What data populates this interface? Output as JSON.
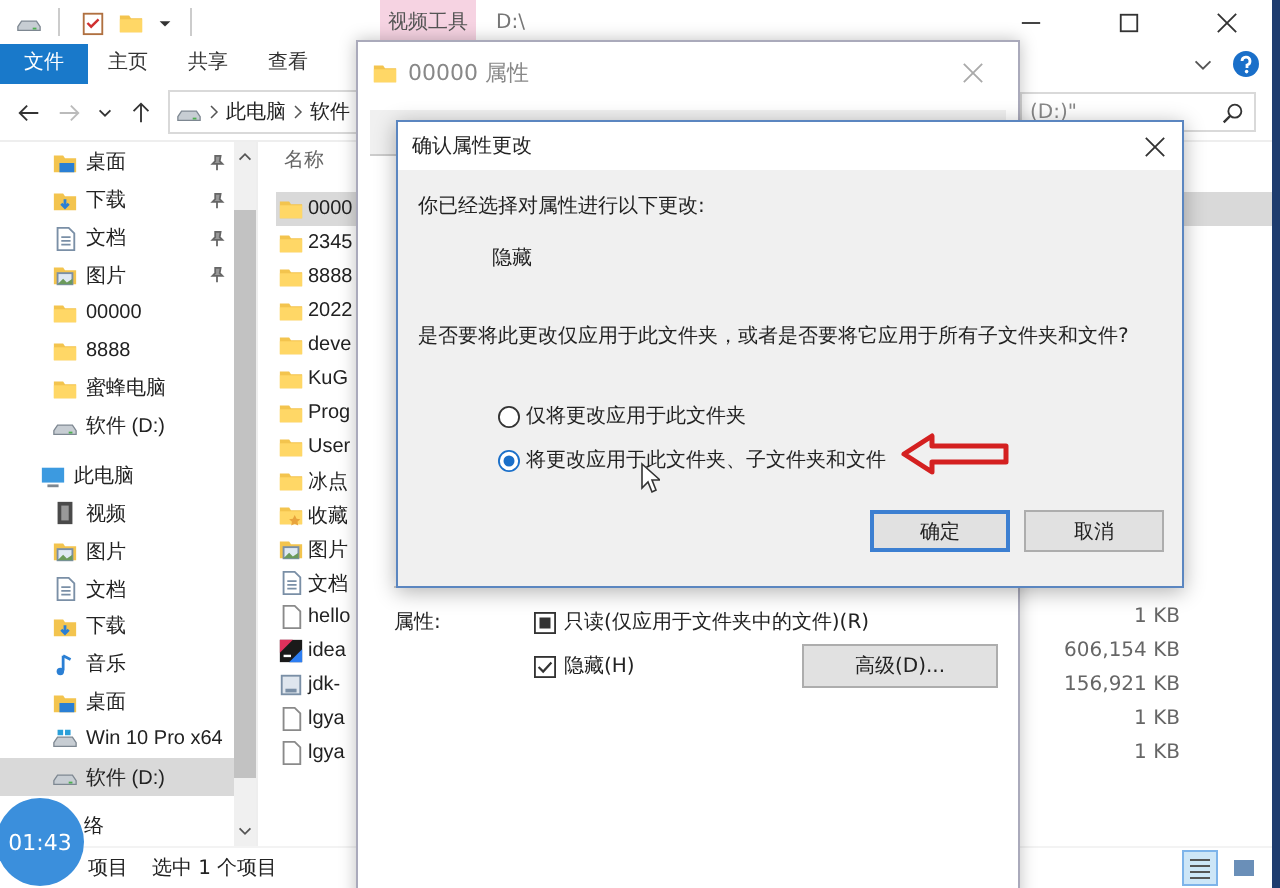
{
  "explorer": {
    "title_bar": {
      "context_tab": "视频工具",
      "path": "D:\\"
    },
    "ribbon_tabs": [
      {
        "label": "文件",
        "selected": true
      },
      {
        "label": "主页",
        "selected": false
      },
      {
        "label": "共享",
        "selected": false
      },
      {
        "label": "查看",
        "selected": false
      }
    ],
    "address": {
      "crumbs": [
        "此电脑",
        "软件"
      ]
    },
    "search": {
      "placeholder": "(D:)\""
    },
    "quick_access": [
      {
        "label": "桌面",
        "kind": "desktop",
        "pinned": true,
        "selected": false
      },
      {
        "label": "下载",
        "kind": "download",
        "pinned": true,
        "selected": false
      },
      {
        "label": "文档",
        "kind": "documents",
        "pinned": true,
        "selected": false
      },
      {
        "label": "图片",
        "kind": "pictures",
        "pinned": true,
        "selected": false
      },
      {
        "label": "00000",
        "kind": "folder",
        "pinned": false,
        "selected": false
      },
      {
        "label": "8888",
        "kind": "folder",
        "pinned": false,
        "selected": false
      },
      {
        "label": "蜜蜂电脑",
        "kind": "folder",
        "pinned": false,
        "selected": false
      },
      {
        "label": "软件 (D:)",
        "kind": "drive",
        "pinned": false,
        "selected": false
      }
    ],
    "tree": [
      {
        "label": "此电脑",
        "kind": "pc",
        "selected": false,
        "children": [
          {
            "label": "视频",
            "kind": "videos",
            "selected": false
          },
          {
            "label": "图片",
            "kind": "pictures",
            "selected": false
          },
          {
            "label": "文档",
            "kind": "documents",
            "selected": false
          },
          {
            "label": "下载",
            "kind": "download",
            "selected": false
          },
          {
            "label": "音乐",
            "kind": "music",
            "selected": false
          },
          {
            "label": "桌面",
            "kind": "desktop",
            "selected": false
          },
          {
            "label": "Win 10 Pro x64",
            "kind": "os-drive",
            "selected": false
          },
          {
            "label": "软件 (D:)",
            "kind": "drive",
            "selected": true
          }
        ]
      },
      {
        "label": "络",
        "kind": "hidden",
        "selected": false
      }
    ],
    "files": {
      "column": "名称",
      "rows": [
        {
          "name": "0000",
          "kind": "folder",
          "selected": true
        },
        {
          "name": "2345",
          "kind": "folder",
          "selected": false
        },
        {
          "name": "8888",
          "kind": "folder",
          "selected": false
        },
        {
          "name": "2022",
          "kind": "folder",
          "selected": false
        },
        {
          "name": "deve",
          "kind": "folder",
          "selected": false
        },
        {
          "name": "KuG",
          "kind": "folder",
          "selected": false
        },
        {
          "name": "Prog",
          "kind": "folder",
          "selected": false
        },
        {
          "name": "User",
          "kind": "folder",
          "selected": false
        },
        {
          "name": "冰点",
          "kind": "folder",
          "selected": false
        },
        {
          "name": "收藏",
          "kind": "favorites",
          "selected": false
        },
        {
          "name": "图片",
          "kind": "pictures",
          "selected": false
        },
        {
          "name": "文档",
          "kind": "documents",
          "selected": false
        },
        {
          "name": "hello",
          "kind": "file",
          "size": "1 KB",
          "selected": false
        },
        {
          "name": "idea",
          "kind": "app",
          "size": "606,154 KB",
          "selected": false
        },
        {
          "name": "jdk-",
          "kind": "installer",
          "size": "156,921 KB",
          "selected": false
        },
        {
          "name": "lgya",
          "kind": "file",
          "size": "1 KB",
          "selected": false
        },
        {
          "name": "lgya",
          "kind": "file",
          "size": "1 KB",
          "selected": false
        }
      ]
    },
    "status_bar": {
      "count": "项目",
      "selection": "选中 1 个项目"
    },
    "view_buttons": [
      {
        "kind": "details",
        "selected": true
      },
      {
        "kind": "large-icons",
        "selected": false
      }
    ]
  },
  "properties": {
    "title": "00000 属性",
    "attributes_label": "属性:",
    "attributes": [
      {
        "label": "只读(仅应用于文件夹中的文件)(R)",
        "checked": false,
        "mixed": true
      },
      {
        "label": "隐藏(H)",
        "checked": true,
        "mixed": false
      }
    ],
    "advanced_button": "高级(D)..."
  },
  "confirm": {
    "title": "确认属性更改",
    "intro": "你已经选择对属性进行以下更改:",
    "change": "隐藏",
    "question": "是否要将此更改仅应用于此文件夹，或者是否要将它应用于所有子文件夹和文件?",
    "options": [
      {
        "label": "仅将更改应用于此文件夹",
        "selected": false
      },
      {
        "label": "将更改应用于此文件夹、子文件夹和文件",
        "selected": true
      }
    ],
    "buttons": [
      {
        "label": "确定",
        "default": true
      },
      {
        "label": "取消",
        "default": false
      }
    ]
  },
  "timer": "01:43"
}
